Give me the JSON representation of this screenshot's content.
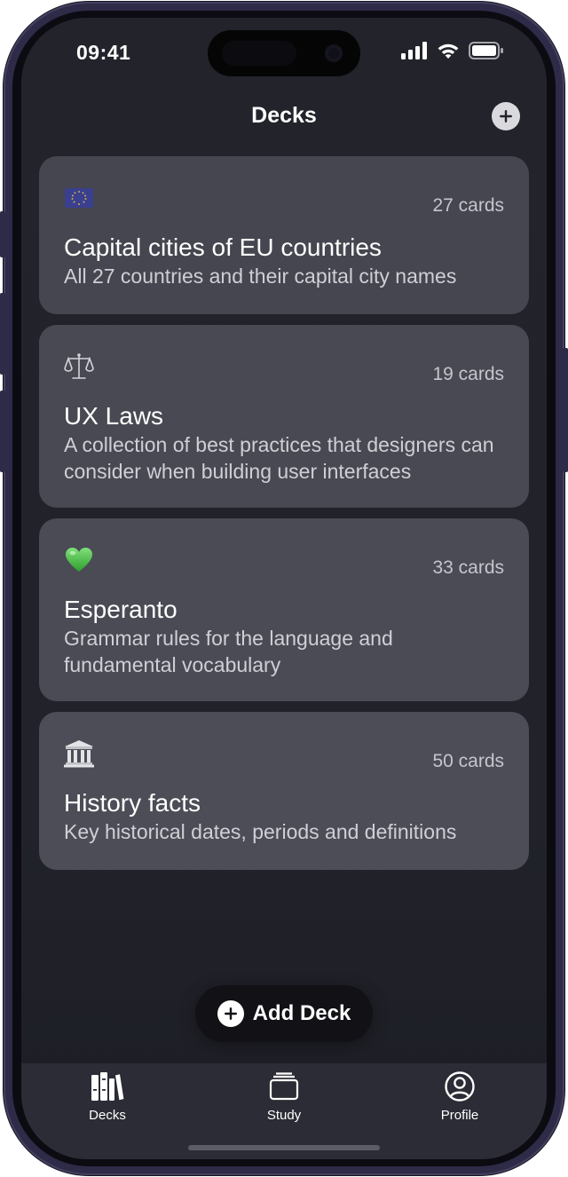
{
  "status_bar": {
    "time": "09:41",
    "icons": [
      "signal-icon",
      "wifi-icon",
      "battery-icon"
    ]
  },
  "header": {
    "title": "Decks",
    "add_icon": "plus-circle-icon"
  },
  "decks": [
    {
      "icon": "eu-flag-icon",
      "count": "27 cards",
      "title": "Capital cities of EU countries",
      "description": "All 27 countries and their capital city names"
    },
    {
      "icon": "scales-icon",
      "count": "19 cards",
      "title": "UX Laws",
      "description": "A collection of best practices that designers can consider when building user interfaces"
    },
    {
      "icon": "green-heart-icon",
      "count": "33 cards",
      "title": "Esperanto",
      "description": "Grammar rules for the language and fundamental vocabulary"
    },
    {
      "icon": "classical-building-icon",
      "count": "50 cards",
      "title": "History facts",
      "description": "Key historical dates, periods and definitions"
    }
  ],
  "add_deck_button": {
    "label": "Add Deck",
    "icon": "plus-circle-icon"
  },
  "tab_bar": {
    "items": [
      {
        "label": "Decks",
        "icon": "library-books-icon",
        "active": true
      },
      {
        "label": "Study",
        "icon": "card-stack-icon",
        "active": false
      },
      {
        "label": "Profile",
        "icon": "person-circle-icon",
        "active": false
      }
    ]
  },
  "colors": {
    "background": "#22232b",
    "card": "#45464f",
    "tab_bar": "#2b2c35",
    "frame": "#2e2b48",
    "text_primary": "#ffffff",
    "text_secondary": "#cfd0d5"
  }
}
